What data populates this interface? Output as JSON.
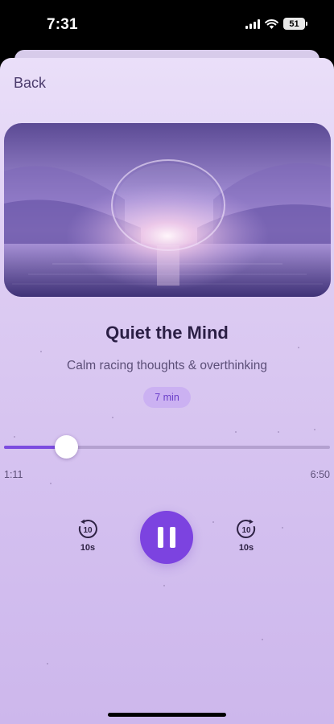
{
  "status_bar": {
    "time": "7:31",
    "battery": "51"
  },
  "nav": {
    "back_label": "Back"
  },
  "session": {
    "title": "Quiet the Mind",
    "subtitle": "Calm racing thoughts & overthinking",
    "duration": "7 min"
  },
  "player": {
    "current_time": "1:11",
    "total_time": "6:50",
    "progress": 0.19,
    "skip_back_label": "10s",
    "skip_forward_label": "10s",
    "skip_icon_text": "10",
    "state": "playing"
  },
  "colors": {
    "accent": "#7c43e0",
    "title": "#2b1f45",
    "chip_bg": "#cbb1f2"
  },
  "icons": {
    "back": "chevron-back",
    "skip_back": "rotate-ccw-10-icon",
    "play_pause": "pause-icon",
    "skip_forward": "rotate-cw-10-icon"
  }
}
